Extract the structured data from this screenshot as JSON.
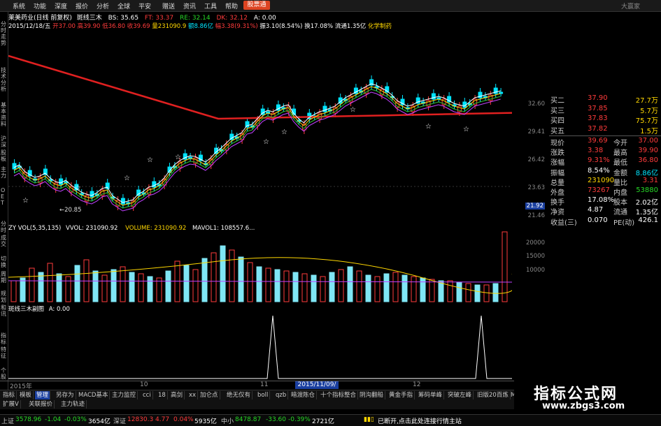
{
  "menu": [
    "系统",
    "功能",
    "深度",
    "报价",
    "分析",
    "全球",
    "平安",
    "赠送",
    "资讯",
    "工具",
    "帮助"
  ],
  "menu_ad": "股票通",
  "menu_right": "大赢家",
  "title_bar": {
    "name": "莱美药业(日线 前复权)",
    "indicator": "斑线三木",
    "bs_label": "BS: 35.65",
    "ft_label": "FT: 33.37",
    "re_label": "RE: 32.14",
    "dk_label": "DK: 32.12",
    "a_label": "A: 0.00"
  },
  "info_row": {
    "date": "2015/12/18/五",
    "open": "开37.00",
    "high": "高39.90",
    "low": "低36.80",
    "close": "收39.69",
    "volume": "量231090.9",
    "amount": "额8.86亿",
    "change": "幅3.38(9.31%)",
    "amplitude": "振3.10(8.54%)",
    "turnover": "换17.08%",
    "float": "流通1.35亿",
    "sector": "化学制药"
  },
  "left_rail": [
    "分时走势",
    "技术分析",
    "基本资料",
    "沪深",
    "股板",
    "主力",
    "OET"
  ],
  "left_rail_lower": [
    "分时",
    "成交",
    "切换",
    "周期",
    "规划",
    "和讯",
    "指标",
    "特征",
    "个股"
  ],
  "main_low_label": "←20.85",
  "price_axis": [
    "32.60",
    "29.41",
    "26.42",
    "23.63",
    "21.92",
    "21.46"
  ],
  "price_highlight": "21.92",
  "volume_panel": {
    "title": "ZY VOL(5,35,135)",
    "vvol": "VVOL: 231090.92",
    "volume": "VOLUME: 231090.92",
    "mavol": "MAVOL1: 108557.6..."
  },
  "volume_axis": [
    "20000",
    "15000",
    "10000"
  ],
  "indicator_panel": {
    "title": "斑线三木副图",
    "a": "A: 0.00"
  },
  "quote": [
    {
      "k": "买二",
      "v": "37.90",
      "v2": "27.7万",
      "c": "red"
    },
    {
      "k": "买三",
      "v": "37.85",
      "v2": "5.7万",
      "c": "red"
    },
    {
      "k": "买四",
      "v": "37.83",
      "v2": "75.7万",
      "c": "red"
    },
    {
      "k": "买五",
      "v": "37.82",
      "v2": "1.5万",
      "c": "red"
    }
  ],
  "quote_detail": [
    {
      "k": "现价",
      "v": "39.69",
      "k2": "今开",
      "v2": "37.00",
      "vc": "red",
      "v2c": "red"
    },
    {
      "k": "涨跌",
      "v": "3.38",
      "k2": "最高",
      "v2": "39.90",
      "vc": "red",
      "v2c": "red"
    },
    {
      "k": "涨幅",
      "v": "9.31%",
      "k2": "最低",
      "v2": "36.80",
      "vc": "red",
      "v2c": "red"
    },
    {
      "k": "振幅",
      "v": "8.54%",
      "k2": "金额",
      "v2": "8.86亿",
      "vc": "white",
      "v2c": "cyan"
    },
    {
      "k": "总量",
      "v": "231090",
      "k2": "量比",
      "v2": "3.31",
      "vc": "yellow",
      "v2c": "red"
    },
    {
      "k": "外盘",
      "v": "73267",
      "k2": "内盘",
      "v2": "53880",
      "vc": "red",
      "v2c": "green"
    },
    {
      "k": "换手",
      "v": "17.08%",
      "k2": "股本",
      "v2": "2.02亿",
      "vc": "white",
      "v2c": "white"
    },
    {
      "k": "净资",
      "v": "4.87",
      "k2": "流通",
      "v2": "1.35亿",
      "vc": "white",
      "v2c": "white"
    },
    {
      "k": "收益(三)",
      "v": "0.070",
      "k2": "PE(动)",
      "v2": "426.1",
      "vc": "white",
      "v2c": "white"
    }
  ],
  "date_axis": {
    "left": "2015年",
    "m10": "10",
    "m11": "11",
    "m12": "12",
    "highlight": "2015/11/09/一"
  },
  "tabs": [
    "指标",
    "模板",
    "管理",
    "另存为",
    "MACD基本",
    "主力监控",
    "cci",
    "18",
    "高剑",
    "xx",
    "加仑点",
    "绝无仅有",
    "boll",
    "qzb",
    "暗渡陈仓",
    "十个指标整合",
    "阴沟翻船",
    "黄金手指",
    "筹码单峰",
    "突破左峰",
    "旧版20百炼",
    "MACD EXPMA共振"
  ],
  "tabs2": [
    "扩展V",
    "关联报价",
    "主力轨迹"
  ],
  "status": {
    "sh_label": "上证",
    "sh_val": "3578.96",
    "sh_chg": "-1.04",
    "sh_pct": "-0.03%",
    "sh_amt": "3654亿",
    "sz_label": "深证",
    "sz_val": "12830.3",
    "sz_chg": "4.77",
    "sz_pct": "0.04%",
    "sz_amt": "5935亿",
    "zx_label": "中小",
    "zx_val": "8478.87",
    "zx_chg": "-33.60",
    "zx_pct": "-0.39%",
    "zx_amt": "2721亿",
    "msg": "已断开,点击此处连接行情主站"
  },
  "watermark": {
    "title": "指标公式网",
    "url": "www.zbgs3.com"
  },
  "colors": {
    "up": "#ff3b3b",
    "down": "#00e5ff",
    "ma_long": "#e02020",
    "ma_short": "#ffffff",
    "ma_mid": "#ffd700",
    "ma_green": "#30c030",
    "ma_purple": "#c040ff"
  }
}
